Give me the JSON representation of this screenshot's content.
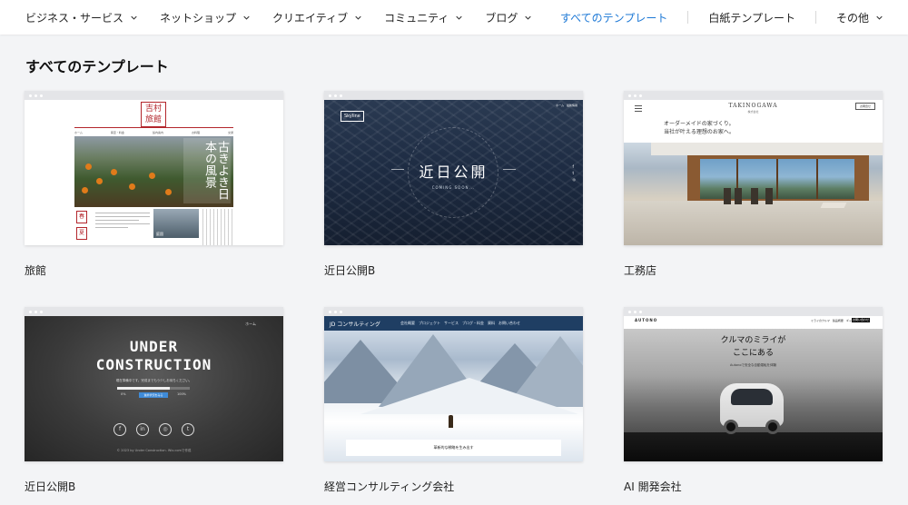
{
  "nav": {
    "left": [
      {
        "label": "ビジネス・サービス"
      },
      {
        "label": "ネットショップ"
      },
      {
        "label": "クリエイティブ"
      },
      {
        "label": "コミュニティ"
      },
      {
        "label": "ブログ"
      }
    ],
    "right": {
      "all": "すべてのテンプレート",
      "blank": "白紙テンプレート",
      "other": "その他"
    },
    "active_color": "#1e79d6"
  },
  "section_title": "すべてのテンプレート",
  "cards": [
    {
      "label": "旅館",
      "thumb": {
        "logo": "吉村旅館",
        "menu": [
          "ホーム",
          "客室・料金",
          "館内案内",
          "お料理",
          "交通"
        ],
        "hero_text": "古きよき日本の風景",
        "hero_text_red": "日本",
        "seal_1": "春",
        "seal_2": "夏",
        "mini_photo_caption": "庭園"
      }
    },
    {
      "label": "近日公開B",
      "thumb": {
        "logo": "Skyline",
        "topnav": "ホーム　最新情報",
        "title": "近日公開",
        "subtitle": "COMING SOON..."
      }
    },
    {
      "label": "工務店",
      "thumb": {
        "brand": "TAKINOGAWA",
        "brand_sub": "株式会社",
        "button": "お問合せ",
        "copy_1": "オーダーメイドの家づくり。",
        "copy_2": "当社が叶える理想のお家へ。"
      }
    },
    {
      "label": "近日公開B",
      "thumb": {
        "nav": "ホーム",
        "heading_1": "UNDER",
        "heading_2": "CONSTRUCTION",
        "desc": "現在準備中です。完成までもう少しお待ちください。",
        "progress": 0.72,
        "pct_left": "0%",
        "pct_right": "100%",
        "cta": "進捗状況をみる",
        "social": [
          "f",
          "in",
          "◎",
          "t"
        ],
        "footer": "© 2023 by Under Construction. Wix.comで作成"
      }
    },
    {
      "label": "経営コンサルティング会社",
      "thumb": {
        "brand": "JD コンサルティング",
        "links": "会社概要　プロジェクト　サービス　ブログ・料金　資料　お問い合わせ",
        "caption": "革新的な戦略を生み出す"
      }
    },
    {
      "label": "AI 開発会社",
      "thumb": {
        "brand": "AUTONO",
        "links": "ミライのクルマ　製品概要　ギャラリー",
        "button": "お問い合わせ",
        "heading_1": "クルマのミライが",
        "heading_2": "ここにある",
        "sub": "Autonoで安全な自動運転を体験"
      }
    }
  ]
}
